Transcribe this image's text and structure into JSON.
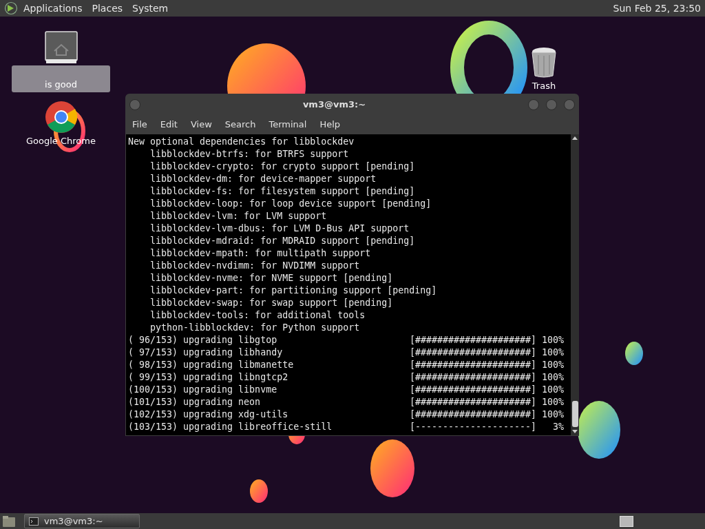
{
  "top_panel": {
    "menus": [
      "Applications",
      "Places",
      "System"
    ],
    "clock": "Sun Feb 25, 23:50"
  },
  "desktop_icons": [
    {
      "kind": "home",
      "label": "is good",
      "selected": true
    },
    {
      "kind": "chrome",
      "label": "Google Chrome",
      "selected": false
    },
    {
      "kind": "trash",
      "label": "Trash",
      "selected": false
    }
  ],
  "terminal": {
    "title": "vm3@vm3:~",
    "menu": [
      "File",
      "Edit",
      "View",
      "Search",
      "Terminal",
      "Help"
    ],
    "lines": [
      "New optional dependencies for libblockdev",
      "    libblockdev-btrfs: for BTRFS support",
      "    libblockdev-crypto: for crypto support [pending]",
      "    libblockdev-dm: for device-mapper support",
      "    libblockdev-fs: for filesystem support [pending]",
      "    libblockdev-loop: for loop device support [pending]",
      "    libblockdev-lvm: for LVM support",
      "    libblockdev-lvm-dbus: for LVM D-Bus API support",
      "    libblockdev-mdraid: for MDRAID support [pending]",
      "    libblockdev-mpath: for multipath support",
      "    libblockdev-nvdimm: for NVDIMM support",
      "    libblockdev-nvme: for NVME support [pending]",
      "    libblockdev-part: for partitioning support [pending]",
      "    libblockdev-swap: for swap support [pending]",
      "    libblockdev-tools: for additional tools",
      "    python-libblockdev: for Python support"
    ],
    "progress": [
      {
        "text": "( 96/153) upgrading libgtop",
        "bar": "[#####################]",
        "percent": "100%"
      },
      {
        "text": "( 97/153) upgrading libhandy",
        "bar": "[#####################]",
        "percent": "100%"
      },
      {
        "text": "( 98/153) upgrading libmanette",
        "bar": "[#####################]",
        "percent": "100%"
      },
      {
        "text": "( 99/153) upgrading libngtcp2",
        "bar": "[#####################]",
        "percent": "100%"
      },
      {
        "text": "(100/153) upgrading libnvme",
        "bar": "[#####################]",
        "percent": "100%"
      },
      {
        "text": "(101/153) upgrading neon",
        "bar": "[#####################]",
        "percent": "100%"
      },
      {
        "text": "(102/153) upgrading xdg-utils",
        "bar": "[#####################]",
        "percent": "100%"
      },
      {
        "text": "(103/153) upgrading libreoffice-still",
        "bar": "[---------------------]",
        "percent": "3%"
      }
    ]
  },
  "taskbar": {
    "tasks": [
      {
        "label": "vm3@vm3:~",
        "selected": true
      }
    ]
  }
}
